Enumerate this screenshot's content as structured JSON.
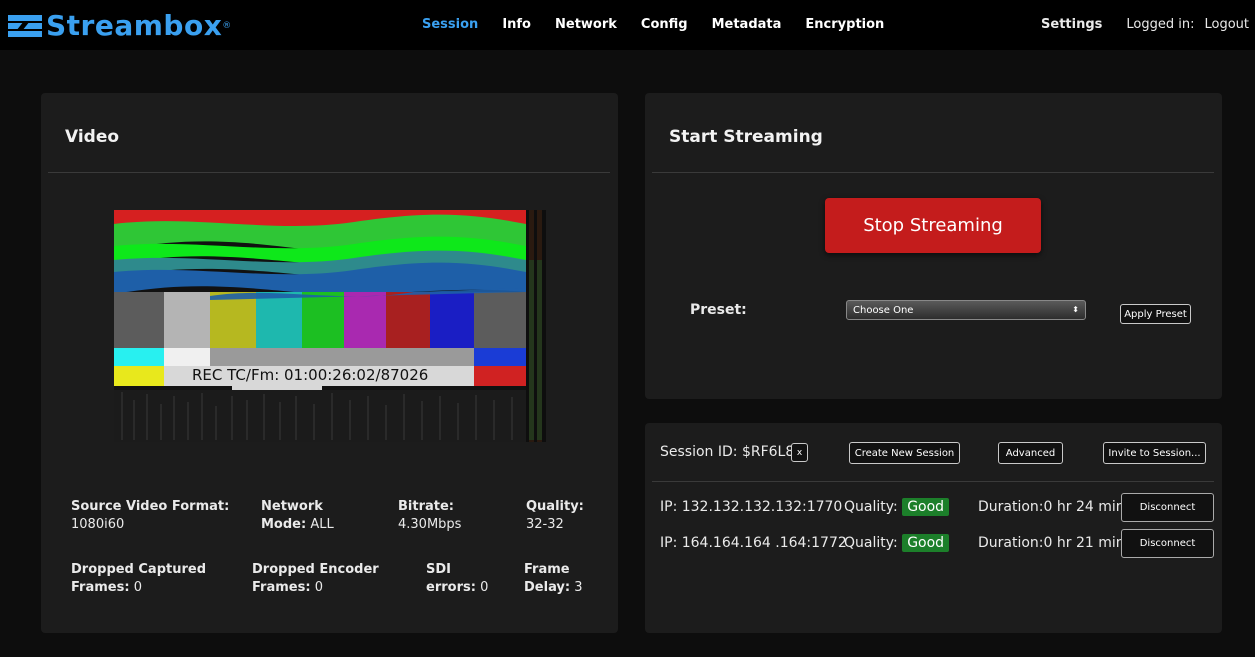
{
  "brand": {
    "name": "Streambox"
  },
  "nav": {
    "items": [
      "Session",
      "Info",
      "Network",
      "Config",
      "Metadata",
      "Encryption"
    ],
    "active": "Session"
  },
  "topright": {
    "settings": "Settings",
    "logged_in": "Logged in:",
    "logout": "Logout"
  },
  "video": {
    "title": "Video",
    "overlay": "REC TC/Fm: 01:00:26:02/87026",
    "stats": {
      "source_label": "Source Video Format:",
      "source_value": "1080i60",
      "netmode_label": "Network",
      "netmode_label2": "Mode:",
      "netmode_value": "ALL",
      "bitrate_label": "Bitrate:",
      "bitrate_value": "4.30Mbps",
      "quality_label": "Quality:",
      "quality_value": "32-32",
      "dropped_cap_label": "Dropped Captured",
      "dropped_cap_label2": "Frames:",
      "dropped_cap_value": "0",
      "dropped_enc_label": "Dropped Encoder",
      "dropped_enc_label2": "Frames:",
      "dropped_enc_value": "0",
      "sdi_label": "SDI",
      "sdi_label2": "errors:",
      "sdi_value": "0",
      "frame_label": "Frame",
      "frame_label2": "Delay:",
      "frame_value": "3"
    }
  },
  "streaming": {
    "title": "Start Streaming",
    "stop_label": "Stop Streaming",
    "preset_label": "Preset:",
    "preset_selected": "Choose One",
    "apply_label": "Apply Preset"
  },
  "session": {
    "id_label": "Session ID: $RF6L8L",
    "clear_label": "x",
    "create_label": "Create New Session",
    "advanced_label": "Advanced",
    "invite_label": "Invite to Session...",
    "connections": [
      {
        "ip": "IP: 132.132.132.132:1770",
        "quality_label": "Quality:",
        "quality": "Good",
        "duration": "Duration:0 hr 24 min",
        "disconnect": "Disconnect"
      },
      {
        "ip": "IP: 164.164.164 .164:1772",
        "quality_label": "Quality:",
        "quality": "Good",
        "duration": "Duration:0 hr 21 min",
        "disconnect": "Disconnect"
      }
    ]
  },
  "colors": {
    "accent": "#3aa0f0",
    "stop": "#c41c1c",
    "good": "#1c7f2a",
    "panel": "#1c1c1c"
  }
}
